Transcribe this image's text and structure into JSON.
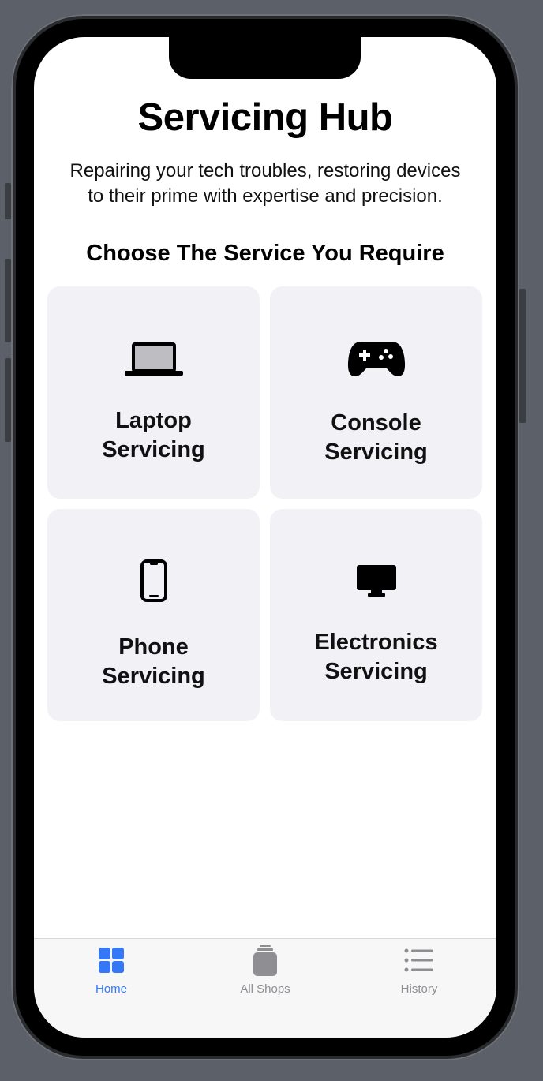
{
  "header": {
    "title": "Servicing Hub",
    "subtitle_line1": "Repairing your tech troubles, restoring devices",
    "subtitle_line2": "to their prime with expertise and precision."
  },
  "section_title": "Choose The Service You Require",
  "services": [
    {
      "line1": "Laptop",
      "line2": "Servicing",
      "icon": "laptop-icon"
    },
    {
      "line1": "Console",
      "line2": "Servicing",
      "icon": "gamecontroller-icon"
    },
    {
      "line1": "Phone",
      "line2": "Servicing",
      "icon": "iphone-icon"
    },
    {
      "line1": "Electronics",
      "line2": "Servicing",
      "icon": "desktop-computer-icon"
    }
  ],
  "tabbar": {
    "active_color": "#3478f6",
    "inactive_color": "#8e8e93",
    "tabs": [
      {
        "label": "Home",
        "icon": "square-grid-icon",
        "active": true
      },
      {
        "label": "All Shops",
        "icon": "shopping-bag-icon",
        "active": false
      },
      {
        "label": "History",
        "icon": "list-bullet-icon",
        "active": false
      }
    ]
  }
}
